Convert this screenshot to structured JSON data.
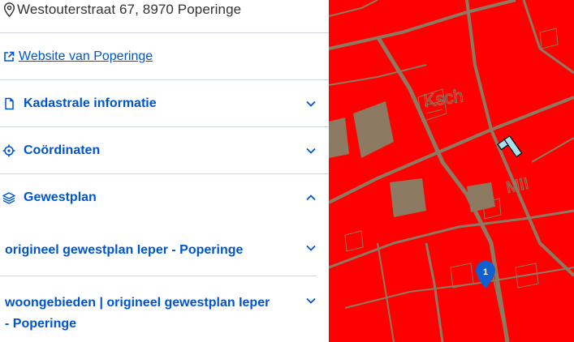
{
  "address": {
    "text": "Westouterstraat 67, 8970 Poperinge",
    "icon": "location-pin-icon"
  },
  "website": {
    "text": "Website van Poperinge",
    "icon": "external-link-icon"
  },
  "accordion": [
    {
      "label": "Kadastrale informatie",
      "icon": "document-icon",
      "expanded": false
    },
    {
      "label": "Coördinaten",
      "icon": "crosshair-icon",
      "expanded": false
    },
    {
      "label": "Gewestplan",
      "icon": "layers-icon",
      "expanded": true
    }
  ],
  "gewestplan_items": [
    {
      "line1": "origineel gewestplan Ieper - Poperinge",
      "line2": ""
    },
    {
      "line1": "woongebieden | origineel gewestplan Ieper",
      "line2": "- Poperinge"
    }
  ],
  "map": {
    "marker_label": "1",
    "colors": {
      "zone": "#ff0000",
      "parcel": "#8c7a62",
      "marker": "#1060d0",
      "link": "#0055cc"
    }
  }
}
